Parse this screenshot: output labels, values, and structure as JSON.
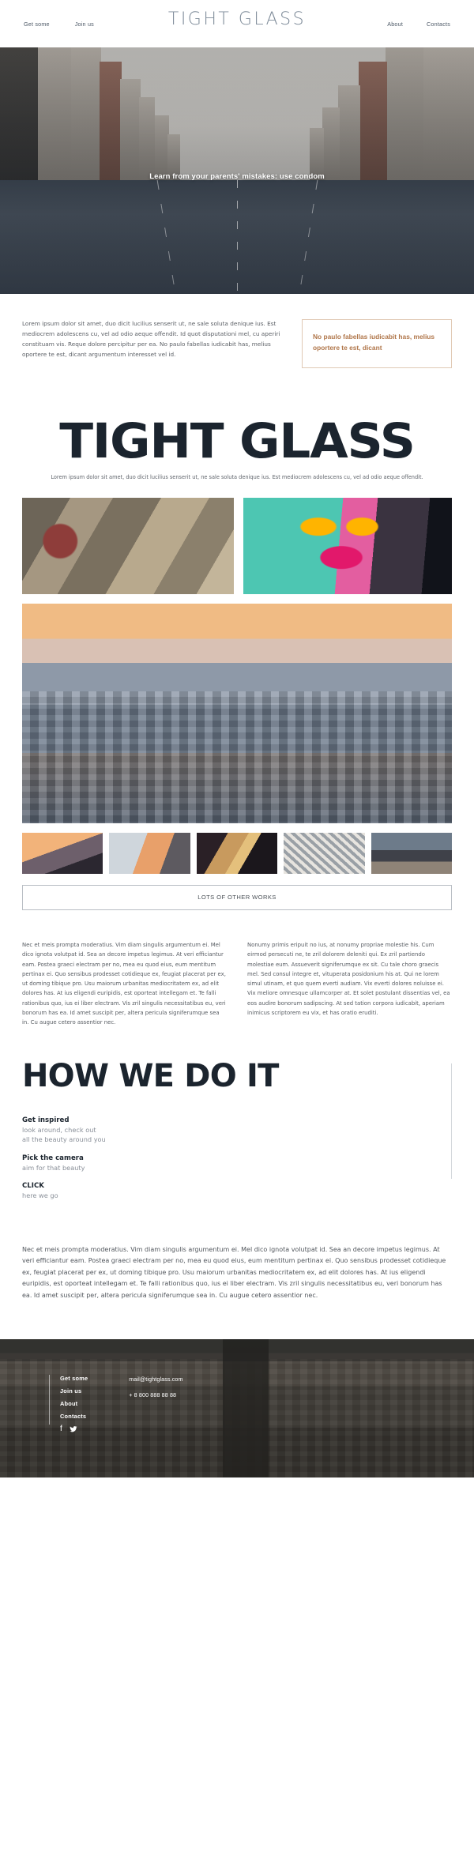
{
  "header": {
    "brand": "TIGHT GLASS",
    "nav_left": [
      {
        "label": "Get some"
      },
      {
        "label": "Join us"
      }
    ],
    "nav_right": [
      {
        "label": "About"
      },
      {
        "label": "Contacts"
      }
    ]
  },
  "hero": {
    "caption": "Learn from your parents' mistakes: use condom"
  },
  "intro": {
    "paragraph": "Lorem ipsum dolor sit amet, duo dicit lucilius senserit ut, ne sale soluta denique ius. Est mediocrem adolescens cu, vel ad odio aeque offendit. Id quot disputationi mel, cu aperiri constituam vis. Reque dolore percipitur per ea. No paulo fabellas iudicabit has, melius oportere te est, dicant argumentum interesset vel id.",
    "quote": "No paulo fabellas iudicabit has, melius oportere te est, dicant",
    "quote_color": "#b0764a",
    "quote_border_color": "#e0c9b4"
  },
  "feature": {
    "title": "TIGHT GLASS",
    "subtitle": "Lorem ipsum dolor sit amet, duo dicit lucilius senserit ut, ne sale soluta denique ius. Est mediocrem adolescens cu, vel ad odio aeque offendit."
  },
  "gallery": {
    "images": [
      {
        "name": "ornate-stone-facade-photo"
      },
      {
        "name": "graffiti-sunglasses-face-photo"
      },
      {
        "name": "city-skyline-aerial-sunset-photo"
      }
    ],
    "thumbs": [
      {
        "name": "hand-at-sunset-thumb"
      },
      {
        "name": "bridge-at-night-thumb"
      },
      {
        "name": "woman-blonde-hair-thumb"
      },
      {
        "name": "aerial-rooftops-thumb"
      },
      {
        "name": "people-on-promenade-thumb"
      }
    ],
    "works_button": "LOTS OF OTHER WORKS"
  },
  "columns": {
    "left": "Nec et meis prompta moderatius. Vim diam singulis argumentum ei. Mel dico ignota volutpat id. Sea an decore impetus legimus. At veri efficiantur eam. Postea graeci electram per no, mea eu quod eius, eum mentitum pertinax ei. Quo sensibus prodesset cotidieque ex, feugiat placerat per ex, ut doming tibique pro. Usu maiorum urbanitas mediocritatem ex, ad elit dolores has. At ius eligendi euripidis, est oporteat intellegam et. Te falli rationibus quo, ius ei liber electram. Vis zril singulis necessitatibus eu, veri bonorum has ea. Id amet suscipit per, altera pericula signiferumque sea in. Cu augue cetero assentior nec.",
    "right": "Nonumy primis eripuit no ius, at nonumy propriae molestie his. Cum eirmod persecuti ne, te zril dolorem deleniti qui. Ex zril partiendo molestiae eum. Assueverit signiferumque ex sit. Cu tale choro graecis mel. Sed consul integre et, vituperata posidonium his at. Qui ne lorem simul utinam, et quo quem everti audiam. Vix everti dolores noluisse ei. Vix meliore omnesque ullamcorper at. Et solet postulant dissentias vel, ea eos audire bonorum sadipscing. At sed tation corpora iudicabit, aperiam inimicus scriptorem eu vix, et has oratio eruditi."
  },
  "how": {
    "title": "HOW WE DO IT",
    "steps": [
      {
        "title": "Get inspired",
        "desc_line1": "look around, check out",
        "desc_line2": "all the beauty around you"
      },
      {
        "title": "Pick the camera",
        "desc_line1": "aim for that beauty",
        "desc_line2": ""
      },
      {
        "title": "CLICK",
        "desc_line1": "here we go",
        "desc_line2": ""
      }
    ]
  },
  "longtext": {
    "body": "Nec et meis prompta moderatius. Vim diam singulis argumentum ei. Mel dico ignota volutpat id. Sea an decore impetus legimus. At veri efficiantur eam. Postea graeci electram per no, mea eu quod eius, eum mentitum pertinax ei. Quo sensibus prodesset cotidieque ex, feugiat placerat per ex, ut doming tibique pro. Usu maiorum urbanitas mediocritatem ex, ad elit dolores has. At ius eligendi euripidis, est oporteat intellegam et. Te falli rationibus quo, ius ei liber electram. Vis zril singulis necessitatibus eu, veri bonorum has ea. Id amet suscipit per, altera pericula signiferumque sea in. Cu augue cetero assentior nec."
  },
  "footer": {
    "links": [
      {
        "label": "Get some"
      },
      {
        "label": "Join us"
      },
      {
        "label": "About"
      },
      {
        "label": "Contacts"
      }
    ],
    "social": [
      {
        "name": "facebook-icon",
        "glyph": "f"
      },
      {
        "name": "twitter-icon",
        "glyph": "🐦"
      }
    ],
    "email": "mail@tightglass.com",
    "phone": "+ 8 800 888 88 88"
  }
}
